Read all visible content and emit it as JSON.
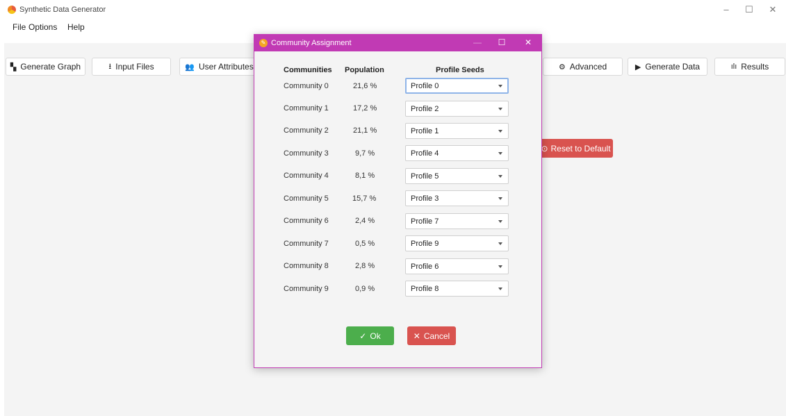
{
  "app": {
    "title": "Synthetic Data Generator",
    "controls": {
      "minimize": "–",
      "maximize": "☐",
      "close": "✕"
    }
  },
  "menu": [
    "File",
    "Options",
    "Help"
  ],
  "tabs": [
    {
      "label": "Generate Graph",
      "icon": "graph-grid-icon",
      "glyph": "▚"
    },
    {
      "label": "Input Files",
      "icon": "download-icon",
      "glyph": "⭳"
    },
    {
      "label": "User Attributes",
      "icon": "users-icon",
      "glyph": "👥"
    },
    {
      "label": "Advanced",
      "icon": "gear-icon",
      "glyph": "⚙"
    },
    {
      "label": "Generate Data",
      "icon": "play-icon",
      "glyph": "▶"
    },
    {
      "label": "Results",
      "icon": "bar-chart-icon",
      "glyph": "ılı"
    }
  ],
  "reset_button": {
    "label": "Reset to Default",
    "glyph": "⊙"
  },
  "dialog": {
    "title": "Community Assignment",
    "controls": {
      "minimize": "—",
      "maximize": "☐",
      "close": "✕"
    },
    "headers": {
      "communities": "Communities",
      "population": "Population",
      "profile_seeds": "Profile Seeds"
    },
    "rows": [
      {
        "community": "Community 0",
        "population": "21,6 %",
        "profile": "Profile 0"
      },
      {
        "community": "Community 1",
        "population": "17,2 %",
        "profile": "Profile 2"
      },
      {
        "community": "Community 2",
        "population": "21,1 %",
        "profile": "Profile 1"
      },
      {
        "community": "Community 3",
        "population": "9,7 %",
        "profile": "Profile 4"
      },
      {
        "community": "Community 4",
        "population": "8,1 %",
        "profile": "Profile 5"
      },
      {
        "community": "Community 5",
        "population": "15,7 %",
        "profile": "Profile 3"
      },
      {
        "community": "Community 6",
        "population": "2,4 %",
        "profile": "Profile 7"
      },
      {
        "community": "Community 7",
        "population": "0,5 %",
        "profile": "Profile 9"
      },
      {
        "community": "Community 8",
        "population": "2,8 %",
        "profile": "Profile 6"
      },
      {
        "community": "Community 9",
        "population": "0,9 %",
        "profile": "Profile 8"
      }
    ],
    "ok_label": "Ok",
    "ok_glyph": "✓",
    "cancel_label": "Cancel",
    "cancel_glyph": "✕"
  },
  "colors": {
    "dialog_accent": "#c13ab4",
    "ok_green": "#4cae4c",
    "danger_red": "#d9534f",
    "focus_blue": "#8fb4e8"
  }
}
